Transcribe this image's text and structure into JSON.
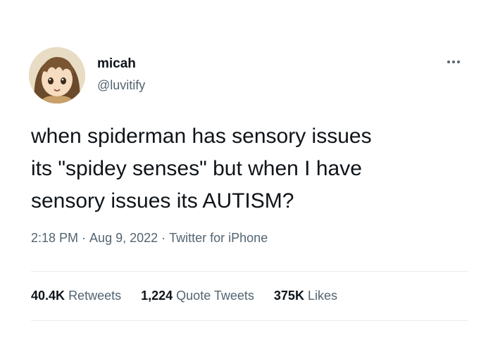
{
  "user": {
    "display_name": "micah",
    "handle": "@luvitify",
    "avatar_icon": "anime-character-avatar"
  },
  "tweet": {
    "text": "when spiderman has sensory issues\nits \"spidey senses\" but when I have\nsensory issues its AUTISM?"
  },
  "meta": {
    "time": "2:18 PM",
    "date": "Aug 9, 2022",
    "source": "Twitter for iPhone",
    "separator": "·"
  },
  "stats": {
    "retweets_count": "40.4K",
    "retweets_label": "Retweets",
    "quotes_count": "1,224",
    "quotes_label": "Quote Tweets",
    "likes_count": "375K",
    "likes_label": "Likes"
  },
  "icons": {
    "more": "more-horizontal-icon"
  },
  "colors": {
    "text_primary": "#0f1419",
    "text_secondary": "#536471",
    "divider": "#e6ecf0",
    "background": "#ffffff"
  }
}
